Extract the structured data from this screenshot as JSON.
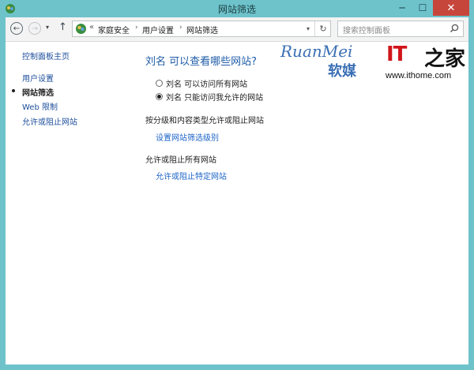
{
  "window": {
    "title": "网站筛选",
    "minimize_glyph": "─",
    "maximize_glyph": "☐",
    "close_glyph": "✕"
  },
  "toolbar": {
    "back_glyph": "←",
    "forward_glyph": "→",
    "recent_glyph": "▾",
    "up_glyph": "↑",
    "address_prefix": "«",
    "breadcrumb": [
      "家庭安全",
      "用户设置",
      "网站筛选"
    ],
    "breadcrumb_separator": "›",
    "dropdown_glyph": "▾",
    "refresh_glyph": "↻",
    "search_placeholder": "搜索控制面板"
  },
  "sidebar": {
    "home_link": "控制面板主页",
    "items": [
      {
        "label": "用户设置",
        "current": false
      },
      {
        "label": "网站筛选",
        "current": true
      },
      {
        "label": "Web 限制",
        "current": false
      },
      {
        "label": "允许或阻止网站",
        "current": false
      }
    ]
  },
  "main": {
    "heading": "刘名 可以查看哪些网站?",
    "options": [
      {
        "label": "刘名 可以访问所有网站",
        "checked": false
      },
      {
        "label": "刘名 只能访问我允许的网站",
        "checked": true
      }
    ],
    "section1_label": "按分级和内容类型允许或阻止网站",
    "section1_link": "设置网站筛选级别",
    "section2_label": "允许或阻止所有网站",
    "section2_link": "允许或阻止特定网站"
  },
  "watermark": {
    "ruanmei": "RuanMei",
    "ruanmei_cn": "软媒",
    "ithome_logo": "IT之家",
    "ithome_url": "www.ithome.com"
  },
  "colors": {
    "titlebar": "#6ec3cb",
    "close_button": "#c7463c",
    "heading": "#1f5ca8",
    "link": "#1e64c8",
    "it_red": "#d0161b"
  }
}
